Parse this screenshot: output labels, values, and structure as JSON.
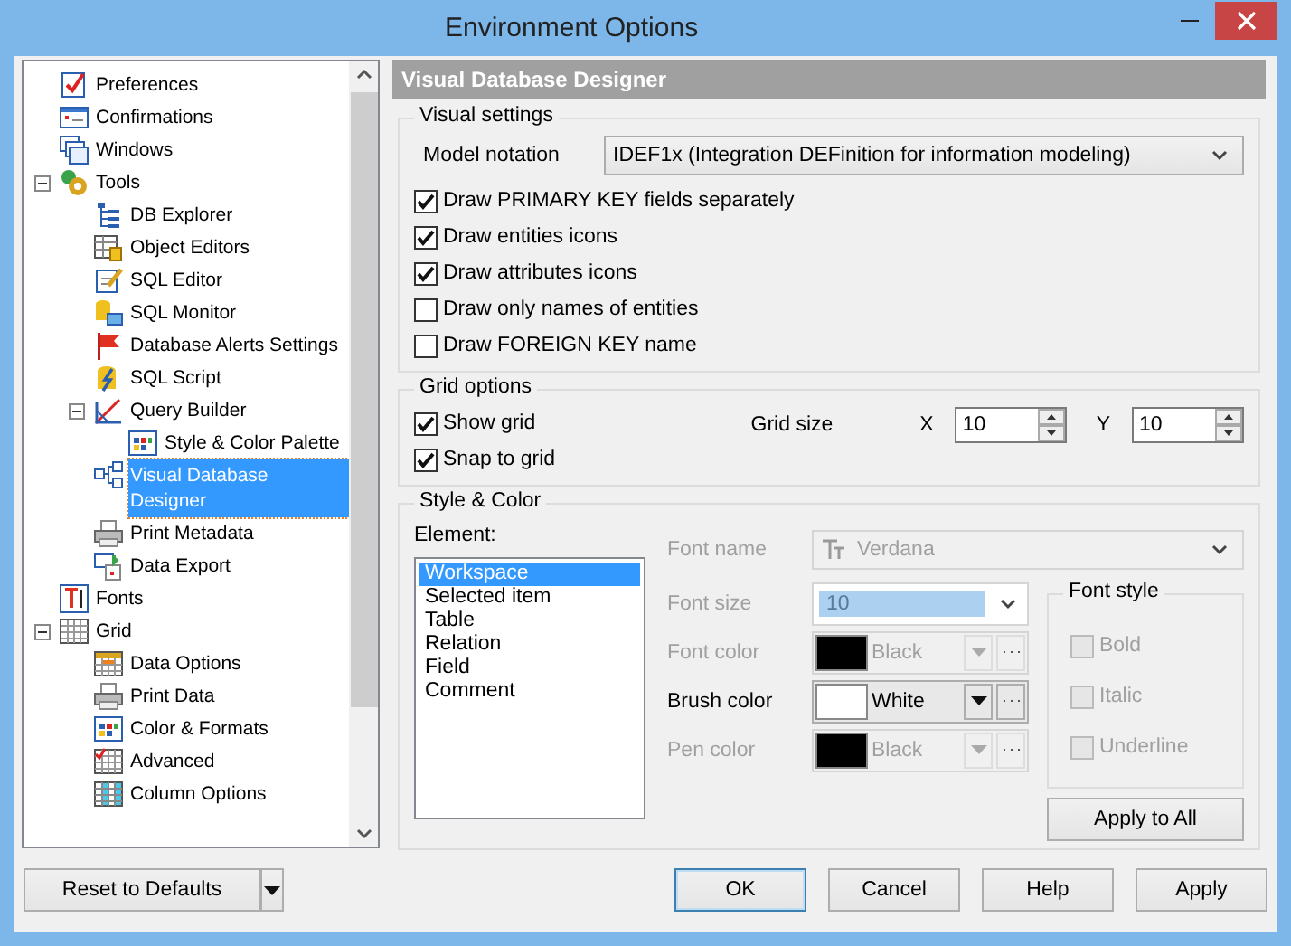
{
  "window": {
    "title": "Environment Options"
  },
  "tree": {
    "items": [
      {
        "label": "Preferences",
        "selected": false
      },
      {
        "label": "Confirmations",
        "selected": false
      },
      {
        "label": "Windows",
        "selected": false
      },
      {
        "label": "Tools",
        "selected": false,
        "expanded": true,
        "children": [
          {
            "label": "DB Explorer",
            "selected": false
          },
          {
            "label": "Object Editors",
            "selected": false
          },
          {
            "label": "SQL Editor",
            "selected": false
          },
          {
            "label": "SQL Monitor",
            "selected": false
          },
          {
            "label": "Database Alerts Settings",
            "selected": false
          },
          {
            "label": "SQL Script",
            "selected": false
          },
          {
            "label": "Query Builder",
            "selected": false,
            "expanded": true,
            "children": [
              {
                "label": "Style & Color Palette",
                "selected": false
              }
            ]
          },
          {
            "label": "Visual Database Designer",
            "selected": true
          },
          {
            "label": "Print Metadata",
            "selected": false
          },
          {
            "label": "Data Export",
            "selected": false
          }
        ]
      },
      {
        "label": "Fonts",
        "selected": false
      },
      {
        "label": "Grid",
        "selected": false,
        "expanded": true,
        "children": [
          {
            "label": "Data Options",
            "selected": false
          },
          {
            "label": "Print Data",
            "selected": false
          },
          {
            "label": "Color & Formats",
            "selected": false
          },
          {
            "label": "Advanced",
            "selected": false
          },
          {
            "label": "Column Options",
            "selected": false
          }
        ]
      }
    ]
  },
  "panel": {
    "title": "Visual Database Designer",
    "visual_settings": {
      "legend": "Visual settings",
      "model_notation": {
        "label": "Model notation",
        "value": "IDEF1x (Integration DEFinition for information modeling)"
      },
      "options": [
        {
          "label": "Draw PRIMARY KEY fields separately",
          "checked": true
        },
        {
          "label": "Draw entities icons",
          "checked": true
        },
        {
          "label": "Draw attributes icons",
          "checked": true
        },
        {
          "label": "Draw only names of entities",
          "checked": false
        },
        {
          "label": "Draw FOREIGN KEY name",
          "checked": false
        }
      ]
    },
    "grid_options": {
      "legend": "Grid options",
      "options": [
        {
          "label": "Show grid",
          "checked": true
        },
        {
          "label": "Snap to grid",
          "checked": true
        }
      ],
      "grid_size": {
        "label": "Grid size",
        "x": {
          "label": "X",
          "value": "10"
        },
        "y": {
          "label": "Y",
          "value": "10"
        }
      }
    },
    "style_color": {
      "legend": "Style & Color",
      "element_label": "Element:",
      "elements": [
        {
          "label": "Workspace",
          "selected": true
        },
        {
          "label": "Selected item",
          "selected": false
        },
        {
          "label": "Table",
          "selected": false
        },
        {
          "label": "Relation",
          "selected": false
        },
        {
          "label": "Field",
          "selected": false
        },
        {
          "label": "Comment",
          "selected": false
        }
      ],
      "font_name": {
        "label": "Font name",
        "value": "Verdana",
        "disabled": true
      },
      "props": [
        {
          "kind": "size",
          "label": "Font size",
          "value": "10",
          "disabled": true
        },
        {
          "kind": "color",
          "label": "Font color",
          "value": "Black",
          "color": "#000000",
          "disabled": true
        },
        {
          "kind": "color",
          "label": "Brush color",
          "value": "White",
          "color": "#ffffff",
          "disabled": false
        },
        {
          "kind": "color",
          "label": "Pen color",
          "value": "Black",
          "color": "#000000",
          "disabled": true
        }
      ],
      "font_style": {
        "legend": "Font style",
        "options": [
          {
            "label": "Bold",
            "checked": false,
            "disabled": true
          },
          {
            "label": "Italic",
            "checked": false,
            "disabled": true
          },
          {
            "label": "Underline",
            "checked": false,
            "disabled": true
          }
        ]
      },
      "apply_button": "Apply to All"
    }
  },
  "buttons": {
    "reset": "Reset to Defaults",
    "actions": [
      {
        "label": "OK",
        "default": true
      },
      {
        "label": "Cancel",
        "default": false
      },
      {
        "label": "Help",
        "default": false
      },
      {
        "label": "Apply",
        "default": false
      }
    ]
  }
}
